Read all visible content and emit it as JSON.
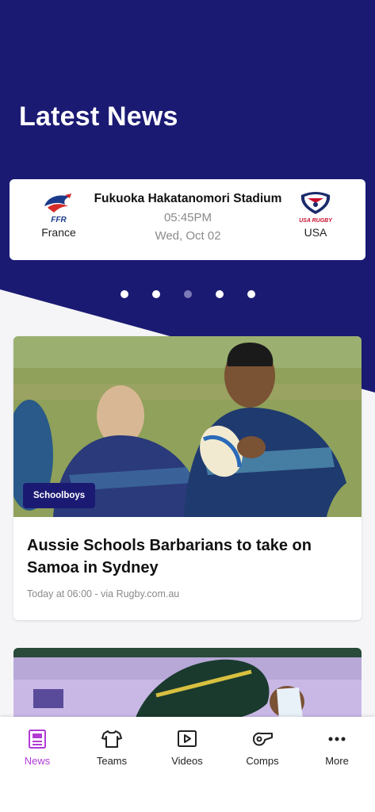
{
  "colors": {
    "brand_navy": "#1b1a73",
    "active_tab": "#b23bd6",
    "carousel_dot_active": "#7c79b8"
  },
  "hero": {
    "title": "Latest News"
  },
  "match": {
    "home_team": {
      "name": "France",
      "logo": "ffr-rooster-logo"
    },
    "away_team": {
      "name": "USA",
      "logo": "usa-rugby-eagle-logo"
    },
    "venue": "Fukuoka Hakatanomori Stadium",
    "time": "05:45PM",
    "date": "Wed, Oct 02"
  },
  "carousel": {
    "total": 5,
    "active_index": 3
  },
  "news": [
    {
      "category": "Schoolboys",
      "headline": "Aussie Schools Barbarians to take on Samoa in Sydney",
      "meta": "Today at 06:00 - via Rugby.com.au",
      "image": "rugby-player-carrying-ball-photo"
    },
    {
      "image": "wallabies-training-photo"
    }
  ],
  "tabbar": {
    "items": [
      {
        "label": "News",
        "icon": "news-icon",
        "active": true
      },
      {
        "label": "Teams",
        "icon": "jersey-icon",
        "active": false
      },
      {
        "label": "Videos",
        "icon": "play-icon",
        "active": false
      },
      {
        "label": "Comps",
        "icon": "whistle-icon",
        "active": false
      },
      {
        "label": "More",
        "icon": "more-dots-icon",
        "active": false
      }
    ]
  }
}
